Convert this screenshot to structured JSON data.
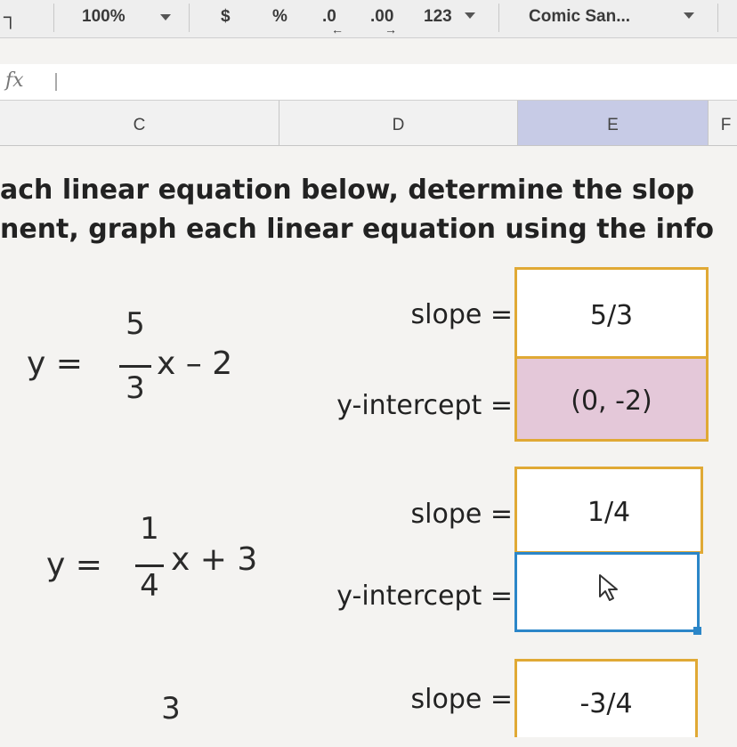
{
  "toolbar": {
    "zoom": "100%",
    "currency": "$",
    "percent": "%",
    "dec_decrease": ".0",
    "dec_increase": ".00",
    "more_formats": "123",
    "font": "Comic San..."
  },
  "formula_bar": {
    "fx": "fx",
    "value": ""
  },
  "columns": [
    "C",
    "D",
    "E",
    "F"
  ],
  "selected_column": "E",
  "instructions": {
    "line1": "ach linear equation below, determine the slop",
    "line2": "nent, graph each linear equation using the info"
  },
  "equations": [
    {
      "lhs": "y =",
      "num": "5",
      "den": "3",
      "rhs": "x – 2",
      "slope_label": "slope =",
      "slope_value": "5/3",
      "intercept_label": "y-intercept =",
      "intercept_value": "(0, -2)"
    },
    {
      "lhs": "y =",
      "num": "1",
      "den": "4",
      "rhs": "x + 3",
      "slope_label": "slope =",
      "slope_value": "1/4",
      "intercept_label": "y-intercept =",
      "intercept_value": ""
    },
    {
      "num": "3",
      "slope_label": "slope =",
      "slope_value": "-3/4"
    }
  ],
  "colors": {
    "cell_border": "#e0a935",
    "active_border": "#2b86c8",
    "intercept_fill": "#e4c8d9",
    "selected_column_fill": "#c7cbe6"
  }
}
